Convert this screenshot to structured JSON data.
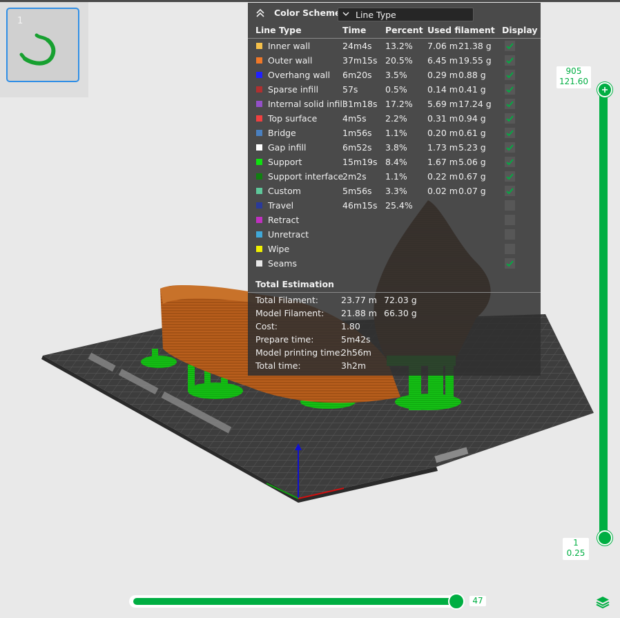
{
  "colors": {
    "accent": "#00ae42",
    "panel_bg": "#303030",
    "selection": "#2f8ee6"
  },
  "thumbnail": {
    "plate_number": "1"
  },
  "color_scheme": {
    "title": "Color Scheme",
    "selected": "Line Type",
    "collapse_icon": "chevron-up-double-icon",
    "dropdown_icon": "chevron-down-icon"
  },
  "columns": {
    "line_type": "Line Type",
    "time": "Time",
    "percent": "Percent",
    "used_filament": "Used filament",
    "display": "Display"
  },
  "rows": [
    {
      "name": "Inner wall",
      "color": "#f5c04a",
      "time": "24m4s",
      "percent": "13.2%",
      "meters": "7.06 m",
      "grams": "21.38 g",
      "display": true
    },
    {
      "name": "Outer wall",
      "color": "#f07828",
      "time": "37m15s",
      "percent": "20.5%",
      "meters": "6.45 m",
      "grams": "19.55 g",
      "display": true
    },
    {
      "name": "Overhang wall",
      "color": "#2020ff",
      "time": "6m20s",
      "percent": "3.5%",
      "meters": "0.29 m",
      "grams": "0.88 g",
      "display": true
    },
    {
      "name": "Sparse infill",
      "color": "#b03030",
      "time": "57s",
      "percent": "0.5%",
      "meters": "0.14 m",
      "grams": "0.41 g",
      "display": true
    },
    {
      "name": "Internal solid infill",
      "color": "#9450c8",
      "time": "31m18s",
      "percent": "17.2%",
      "meters": "5.69 m",
      "grams": "17.24 g",
      "display": true
    },
    {
      "name": "Top surface",
      "color": "#f04040",
      "time": "4m5s",
      "percent": "2.2%",
      "meters": "0.31 m",
      "grams": "0.94 g",
      "display": true
    },
    {
      "name": "Bridge",
      "color": "#4a80c0",
      "time": "1m56s",
      "percent": "1.1%",
      "meters": "0.20 m",
      "grams": "0.61 g",
      "display": true
    },
    {
      "name": "Gap infill",
      "color": "#ffffff",
      "time": "6m52s",
      "percent": "3.8%",
      "meters": "1.73 m",
      "grams": "5.23 g",
      "display": true
    },
    {
      "name": "Support",
      "color": "#10e010",
      "time": "15m19s",
      "percent": "8.4%",
      "meters": "1.67 m",
      "grams": "5.06 g",
      "display": true
    },
    {
      "name": "Support interface",
      "color": "#108010",
      "time": "2m2s",
      "percent": "1.1%",
      "meters": "0.22 m",
      "grams": "0.67 g",
      "display": true
    },
    {
      "name": "Custom",
      "color": "#5ec89a",
      "time": "5m56s",
      "percent": "3.3%",
      "meters": "0.02 m",
      "grams": "0.07 g",
      "display": true
    },
    {
      "name": "Travel",
      "color": "#2a3a9a",
      "time": "46m15s",
      "percent": "25.4%",
      "meters": "",
      "grams": "",
      "display": false
    },
    {
      "name": "Retract",
      "color": "#c030c0",
      "time": "",
      "percent": "",
      "meters": "",
      "grams": "",
      "display": false
    },
    {
      "name": "Unretract",
      "color": "#40a8d8",
      "time": "",
      "percent": "",
      "meters": "",
      "grams": "",
      "display": false
    },
    {
      "name": "Wipe",
      "color": "#f0f000",
      "time": "",
      "percent": "",
      "meters": "",
      "grams": "",
      "display": false
    },
    {
      "name": "Seams",
      "color": "#e8e8e8",
      "time": "",
      "percent": "",
      "meters": "",
      "grams": "",
      "display": true
    }
  ],
  "total": {
    "title": "Total Estimation",
    "items": [
      {
        "label": "Total Filament:",
        "v1": "23.77 m",
        "v2": "72.03 g"
      },
      {
        "label": "Model Filament:",
        "v1": "21.88 m",
        "v2": "66.30 g"
      },
      {
        "label": "Cost:",
        "v1": "1.80",
        "v2": ""
      },
      {
        "label": "Prepare time:",
        "v1": "5m42s",
        "v2": ""
      },
      {
        "label": "Model printing time:",
        "v1": "2h56m",
        "v2": ""
      },
      {
        "label": "Total time:",
        "v1": "3h2m",
        "v2": ""
      }
    ]
  },
  "layer_slider": {
    "top_layer": "905",
    "top_height": "121.60",
    "bottom_layer": "1",
    "bottom_height": "0.25"
  },
  "move_slider": {
    "value": "47"
  },
  "layers_icon": "layers-icon"
}
